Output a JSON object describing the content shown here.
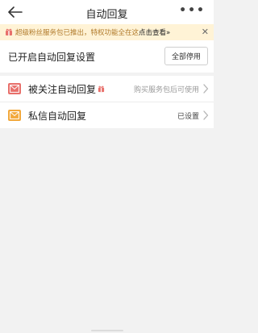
{
  "header": {
    "title": "自动回复",
    "back_icon": "back-arrow-icon",
    "more_icon": "more-dots-icon",
    "more_label": "•••"
  },
  "banner": {
    "text": "超级粉丝服务包已推出，特权功能全在这",
    "link": "点击查看»",
    "close_label": "✕",
    "icon": "gift-icon",
    "colors": {
      "background": "#fff3d6",
      "text": "#b07a2a"
    }
  },
  "settings": {
    "title": "已开启自动回复设置",
    "disable_all": "全部停用"
  },
  "items": [
    {
      "label": "被关注自动回复",
      "status": "购买服务包后可使用",
      "icon": "mail-open-icon",
      "icon_color": "#e8706b",
      "has_badge": true
    },
    {
      "label": "私信自动回复",
      "status": "已设置",
      "icon": "envelope-icon",
      "icon_color": "#f2a83b",
      "has_badge": false
    }
  ]
}
